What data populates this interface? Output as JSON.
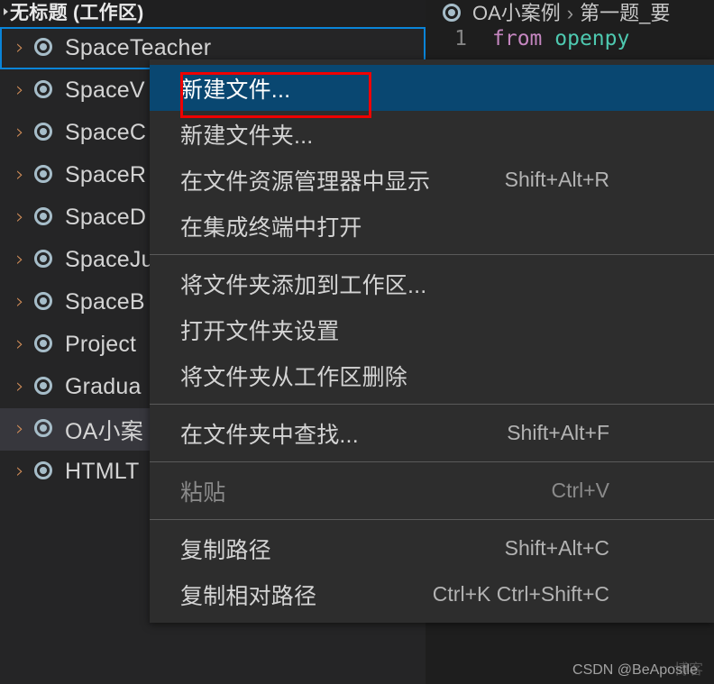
{
  "sidebar": {
    "workspace_title": "无标题 (工作区)",
    "items": [
      {
        "label": "SpaceTeacher",
        "icon": "folder-circle-icon",
        "state": "focused"
      },
      {
        "label": "SpaceV",
        "icon": "folder-circle-icon",
        "state": "normal"
      },
      {
        "label": "SpaceC",
        "icon": "folder-circle-icon",
        "state": "normal"
      },
      {
        "label": "SpaceR",
        "icon": "folder-circle-icon",
        "state": "normal"
      },
      {
        "label": "SpaceD",
        "icon": "folder-circle-icon",
        "state": "normal"
      },
      {
        "label": "SpaceJu",
        "icon": "folder-circle-icon",
        "state": "normal"
      },
      {
        "label": "SpaceB",
        "icon": "folder-circle-icon",
        "state": "normal"
      },
      {
        "label": "Project",
        "icon": "folder-circle-icon",
        "state": "normal"
      },
      {
        "label": "Gradua",
        "icon": "folder-circle-icon",
        "state": "normal"
      },
      {
        "label": "OA小案",
        "icon": "folder-circle-icon",
        "state": "selected"
      },
      {
        "label": "HTMLT",
        "icon": "folder-circle-icon",
        "state": "normal"
      }
    ],
    "chevron": "›"
  },
  "editor": {
    "breadcrumb": {
      "icon": "folder-circle-icon",
      "root": "OA小案例",
      "separator": "›",
      "leaf": "第一题_要"
    },
    "code": {
      "line_number": "1",
      "keyword": "from",
      "module": "openpy"
    }
  },
  "context_menu": {
    "groups": [
      {
        "items": [
          {
            "label": "新建文件...",
            "shortcut": "",
            "state": "highlight"
          },
          {
            "label": "新建文件夹...",
            "shortcut": "",
            "state": "normal"
          },
          {
            "label": "在文件资源管理器中显示",
            "shortcut": "Shift+Alt+R",
            "state": "normal"
          },
          {
            "label": "在集成终端中打开",
            "shortcut": "",
            "state": "normal"
          }
        ]
      },
      {
        "items": [
          {
            "label": "将文件夹添加到工作区...",
            "shortcut": "",
            "state": "normal"
          },
          {
            "label": "打开文件夹设置",
            "shortcut": "",
            "state": "normal"
          },
          {
            "label": "将文件夹从工作区删除",
            "shortcut": "",
            "state": "normal"
          }
        ]
      },
      {
        "items": [
          {
            "label": "在文件夹中查找...",
            "shortcut": "Shift+Alt+F",
            "state": "normal"
          }
        ]
      },
      {
        "items": [
          {
            "label": "粘贴",
            "shortcut": "Ctrl+V",
            "state": "disabled"
          }
        ]
      },
      {
        "items": [
          {
            "label": "复制路径",
            "shortcut": "Shift+Alt+C",
            "state": "normal"
          },
          {
            "label": "复制相对路径",
            "shortcut": "Ctrl+K Ctrl+Shift+C",
            "state": "normal"
          }
        ]
      }
    ]
  },
  "annotation": {
    "target_label": "新建文件...",
    "color": "#ef0000"
  },
  "watermark": {
    "text": "CSDN @BeApostle",
    "ghost": "博客"
  },
  "colors": {
    "sidebar_bg": "#252526",
    "editor_bg": "#1e1e1e",
    "menu_bg": "#2d2d2d",
    "menu_highlight": "#094771",
    "focus_border": "#0a84d8",
    "selection_bg": "#37373d",
    "chevron": "#d8915a",
    "icon": "#a6bdc9",
    "keyword": "#c586c0",
    "module": "#4ec9b0"
  }
}
